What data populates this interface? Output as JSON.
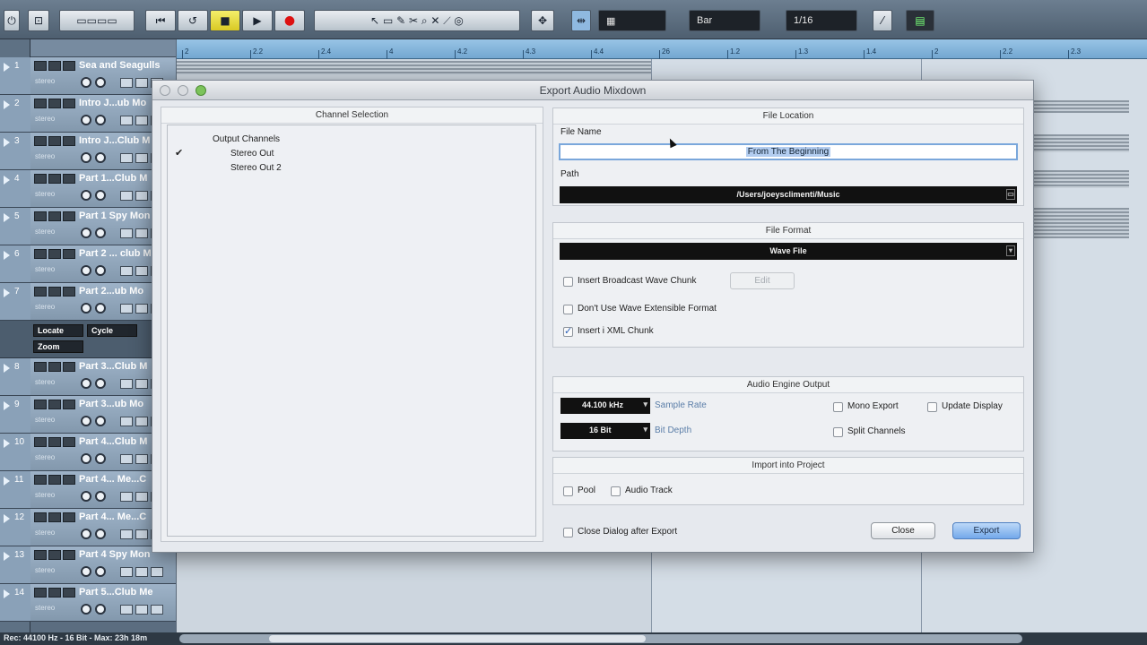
{
  "dialog": {
    "title": "Export Audio Mixdown",
    "channel_selection": {
      "title": "Channel Selection",
      "root": "Output Channels",
      "items": [
        {
          "label": "Stereo Out",
          "checked": true
        },
        {
          "label": "Stereo Out 2",
          "checked": false
        }
      ]
    },
    "file_location": {
      "title": "File Location",
      "file_name_label": "File Name",
      "file_name_value": "From The Beginning",
      "path_label": "Path",
      "path_value": "/Users/joeysclimenti/Music"
    },
    "file_format": {
      "title": "File Format",
      "format_value": "Wave File",
      "options": [
        {
          "label": "Insert Broadcast Wave Chunk",
          "checked": false
        },
        {
          "label": "Don't Use Wave Extensible Format",
          "checked": false
        },
        {
          "label": "Insert i XML Chunk",
          "checked": true
        }
      ],
      "edit_label": "Edit"
    },
    "audio_engine_output": {
      "title": "Audio Engine Output",
      "sample_rate_value": "44.100 kHz",
      "sample_rate_label": "Sample Rate",
      "bit_depth_value": "16 Bit",
      "bit_depth_label": "Bit Depth",
      "mono_export": "Mono Export",
      "update_display": "Update Display",
      "split_channels": "Split Channels"
    },
    "import_into_project": {
      "title": "Import into Project",
      "pool": "Pool",
      "audio_track": "Audio Track"
    },
    "close_after_export": "Close Dialog after Export",
    "close_button": "Close",
    "export_button": "Export"
  },
  "toolbar": {
    "quantize_label": "Bar",
    "grid_value": "1/16"
  },
  "locator": {
    "locate": "Locate",
    "cycle": "Cycle",
    "zoom": "Zoom"
  },
  "tracks": [
    {
      "num": "1",
      "name": "Sea and Seagulls",
      "sub": "stereo"
    },
    {
      "num": "2",
      "name": "Intro J...ub Mo",
      "sub": "stereo"
    },
    {
      "num": "3",
      "name": "Intro J...Club M",
      "sub": "stereo"
    },
    {
      "num": "4",
      "name": "Part 1...Club M",
      "sub": "stereo"
    },
    {
      "num": "5",
      "name": "Part 1 Spy Mon",
      "sub": "stereo"
    },
    {
      "num": "6",
      "name": "Part 2 ... club M",
      "sub": "stereo"
    },
    {
      "num": "7",
      "name": "Part 2...ub Mo",
      "sub": "stereo"
    },
    {
      "num": "8",
      "name": "Part 3...Club M",
      "sub": "stereo"
    },
    {
      "num": "9",
      "name": "Part 3...ub Mo",
      "sub": "stereo"
    },
    {
      "num": "10",
      "name": "Part 4...Club M",
      "sub": "stereo"
    },
    {
      "num": "11",
      "name": "Part 4... Me...C",
      "sub": "stereo"
    },
    {
      "num": "12",
      "name": "Part 4... Me...C",
      "sub": "stereo"
    },
    {
      "num": "13",
      "name": "Part 4 Spy Mon",
      "sub": "stereo"
    },
    {
      "num": "14",
      "name": "Part 5...Club Me",
      "sub": "stereo"
    }
  ],
  "ruler_labels": [
    "2",
    "2.2",
    "2.4",
    "4",
    "4.2",
    "4.3",
    "4.4",
    "26",
    "1.2",
    "1.3",
    "1.4",
    "2",
    "2.2",
    "2.3"
  ],
  "status": {
    "text": "Rec: 44100 Hz - 16 Bit - Max: 23h 18m"
  }
}
